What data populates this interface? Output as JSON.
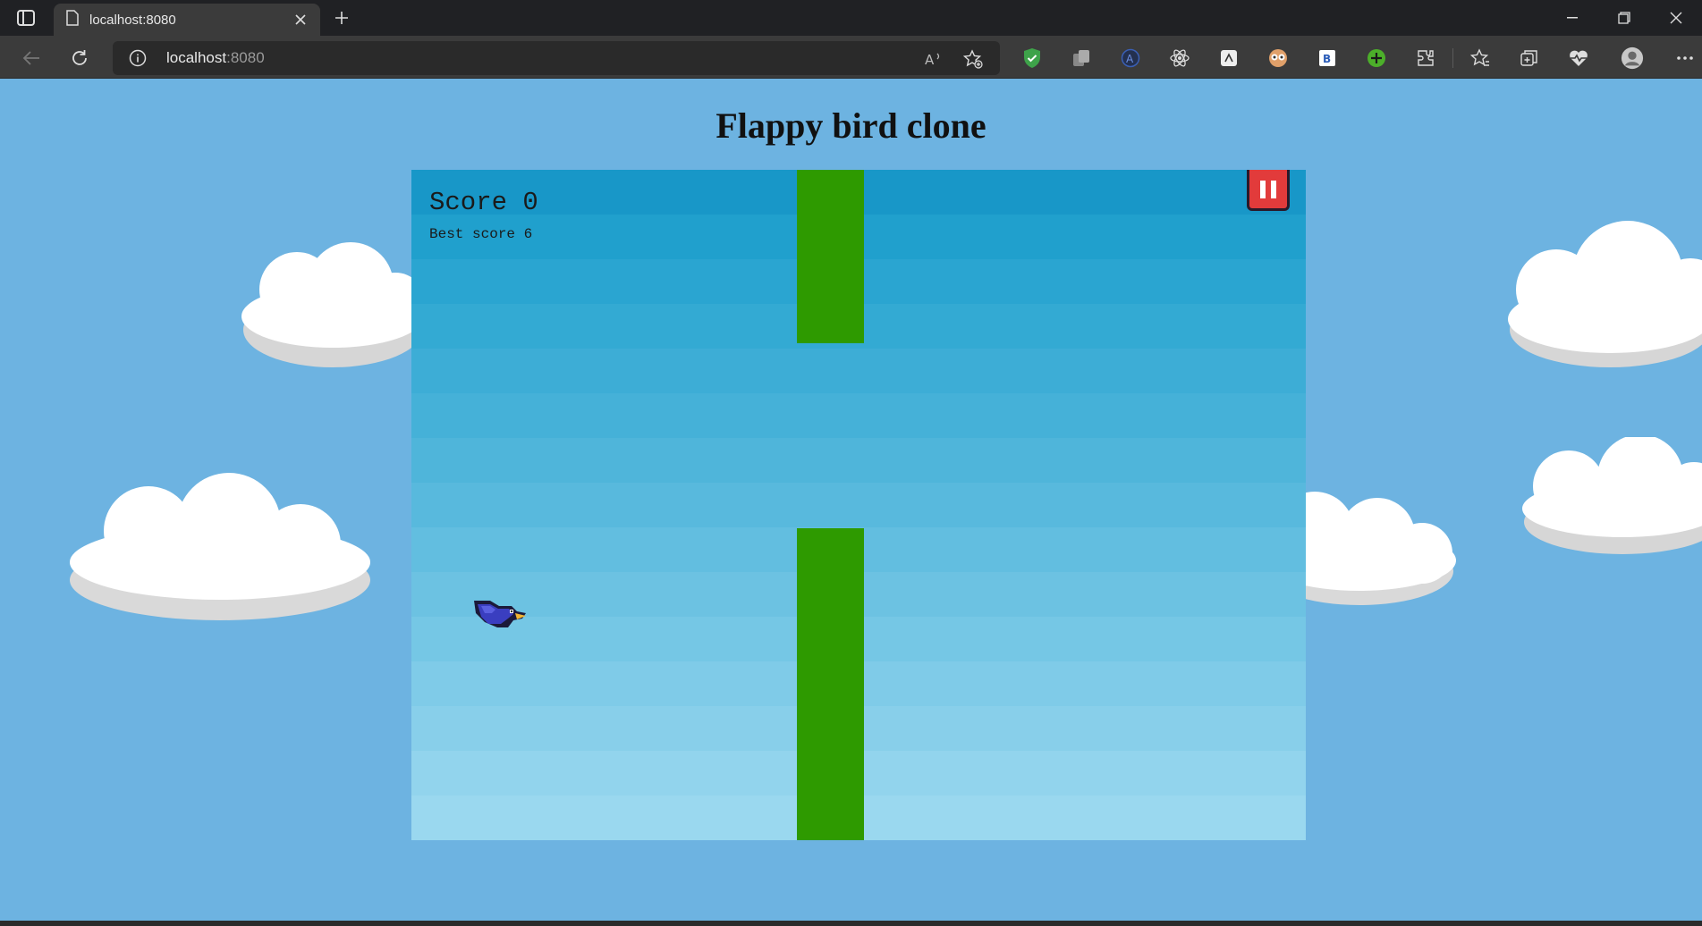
{
  "browser": {
    "tab_title": "localhost:8080",
    "address_host": "localhost",
    "address_port": ":8080"
  },
  "page": {
    "title": "Flappy bird clone"
  },
  "game": {
    "score_label": "Score 0",
    "score": 0,
    "best_label": "Best score 6",
    "best_score": 6,
    "colors": {
      "pipe": "#2e9a00",
      "sky_top": "#1897c8",
      "sky_bottom": "#9ad8ef",
      "pause_button": "#e23b3b",
      "page_background": "#6db3e1"
    },
    "icons": [
      "pause-icon",
      "bird-sprite"
    ]
  }
}
